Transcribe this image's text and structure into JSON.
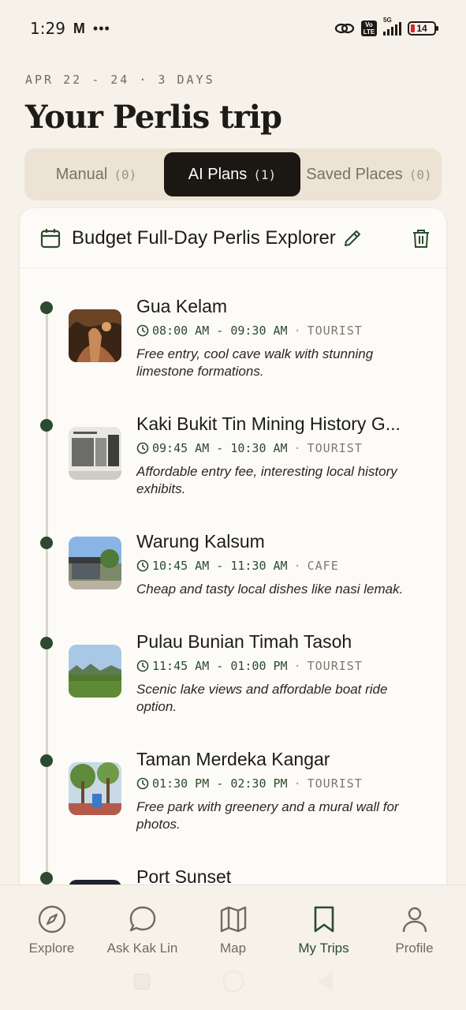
{
  "status_bar": {
    "time": "1:29",
    "mail_glyph": "M",
    "more": "•••",
    "net": "5G",
    "volte": "Vo LTE",
    "battery": "14"
  },
  "header": {
    "dates": "APR 22 - 24 · 3 DAYS",
    "title": "Your Perlis trip"
  },
  "tabs": [
    {
      "label": "Manual",
      "count": "(0)",
      "active": false
    },
    {
      "label": "AI Plans",
      "count": "(1)",
      "active": true
    },
    {
      "label": "Saved Places",
      "count": "(0)",
      "active": false
    }
  ],
  "plan": {
    "title": "Budget Full-Day Perlis Explorer",
    "stops": [
      {
        "name": "Gua Kelam",
        "time": "08:00 AM - 09:30 AM",
        "sep": "·",
        "category": "TOURIST",
        "desc": "Free entry, cool cave walk with stunning limestone formations.",
        "thumb_icon": "cave-photo"
      },
      {
        "name": "Kaki Bukit Tin Mining History G...",
        "time": "09:45 AM - 10:30 AM",
        "sep": "·",
        "category": "TOURIST",
        "desc": "Affordable entry fee, interesting local history exhibits.",
        "thumb_icon": "gallery-photo"
      },
      {
        "name": "Warung Kalsum",
        "time": "10:45 AM - 11:30 AM",
        "sep": "·",
        "category": "CAFE",
        "desc": "Cheap and tasty local dishes like nasi lemak.",
        "thumb_icon": "restaurant-photo"
      },
      {
        "name": "Pulau Bunian Timah Tasoh",
        "time": "11:45 AM - 01:00 PM",
        "sep": "·",
        "category": "TOURIST",
        "desc": "Scenic lake views and affordable boat ride option.",
        "thumb_icon": "lake-photo"
      },
      {
        "name": "Taman Merdeka Kangar",
        "time": "01:30 PM - 02:30 PM",
        "sep": "·",
        "category": "TOURIST",
        "desc": "Free park with greenery and a mural wall for photos.",
        "thumb_icon": "park-photo"
      },
      {
        "name": "Port Sunset",
        "time": "",
        "sep": "",
        "category": "",
        "desc": "",
        "thumb_icon": "sunset-photo"
      }
    ]
  },
  "nav": [
    {
      "label": "Explore",
      "icon": "compass-icon",
      "active": false
    },
    {
      "label": "Ask Kak Lin",
      "icon": "chat-icon",
      "active": false
    },
    {
      "label": "Map",
      "icon": "map-icon",
      "active": false
    },
    {
      "label": "My Trips",
      "icon": "bookmark-icon",
      "active": true
    },
    {
      "label": "Profile",
      "icon": "person-icon",
      "active": false
    }
  ],
  "colors": {
    "accent": "#2c4a2f",
    "background": "#f6f1e9",
    "active_tab": "#1b1814"
  }
}
